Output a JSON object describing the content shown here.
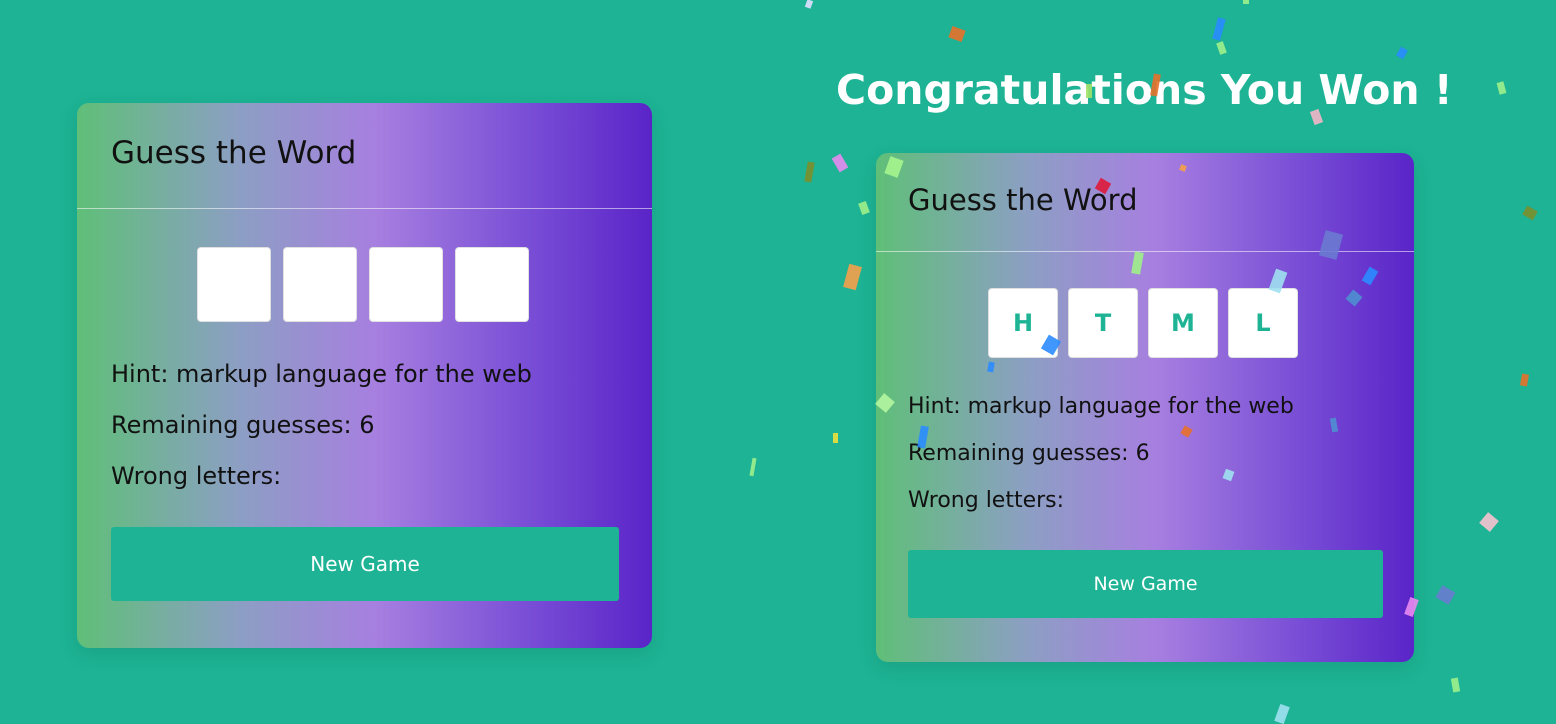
{
  "colors": {
    "background": "#1db394",
    "accent": "#1db394",
    "gradient": [
      "#5fbf78",
      "#a77fe0",
      "#5a24c8"
    ]
  },
  "left_game": {
    "title": "Guess the Word",
    "tiles": [
      "",
      "",
      "",
      ""
    ],
    "hint": "Hint: markup language for the web",
    "remaining": "Remaining guesses: 6",
    "wrong": "Wrong letters:",
    "button_label": "New Game"
  },
  "win_message": "Congratulations You Won !",
  "right_game": {
    "title": "Guess the Word",
    "tiles": [
      "H",
      "T",
      "M",
      "L"
    ],
    "hint": "Hint: markup language for the web",
    "remaining": "Remaining guesses: 6",
    "wrong": "Wrong letters:",
    "button_label": "New Game"
  }
}
